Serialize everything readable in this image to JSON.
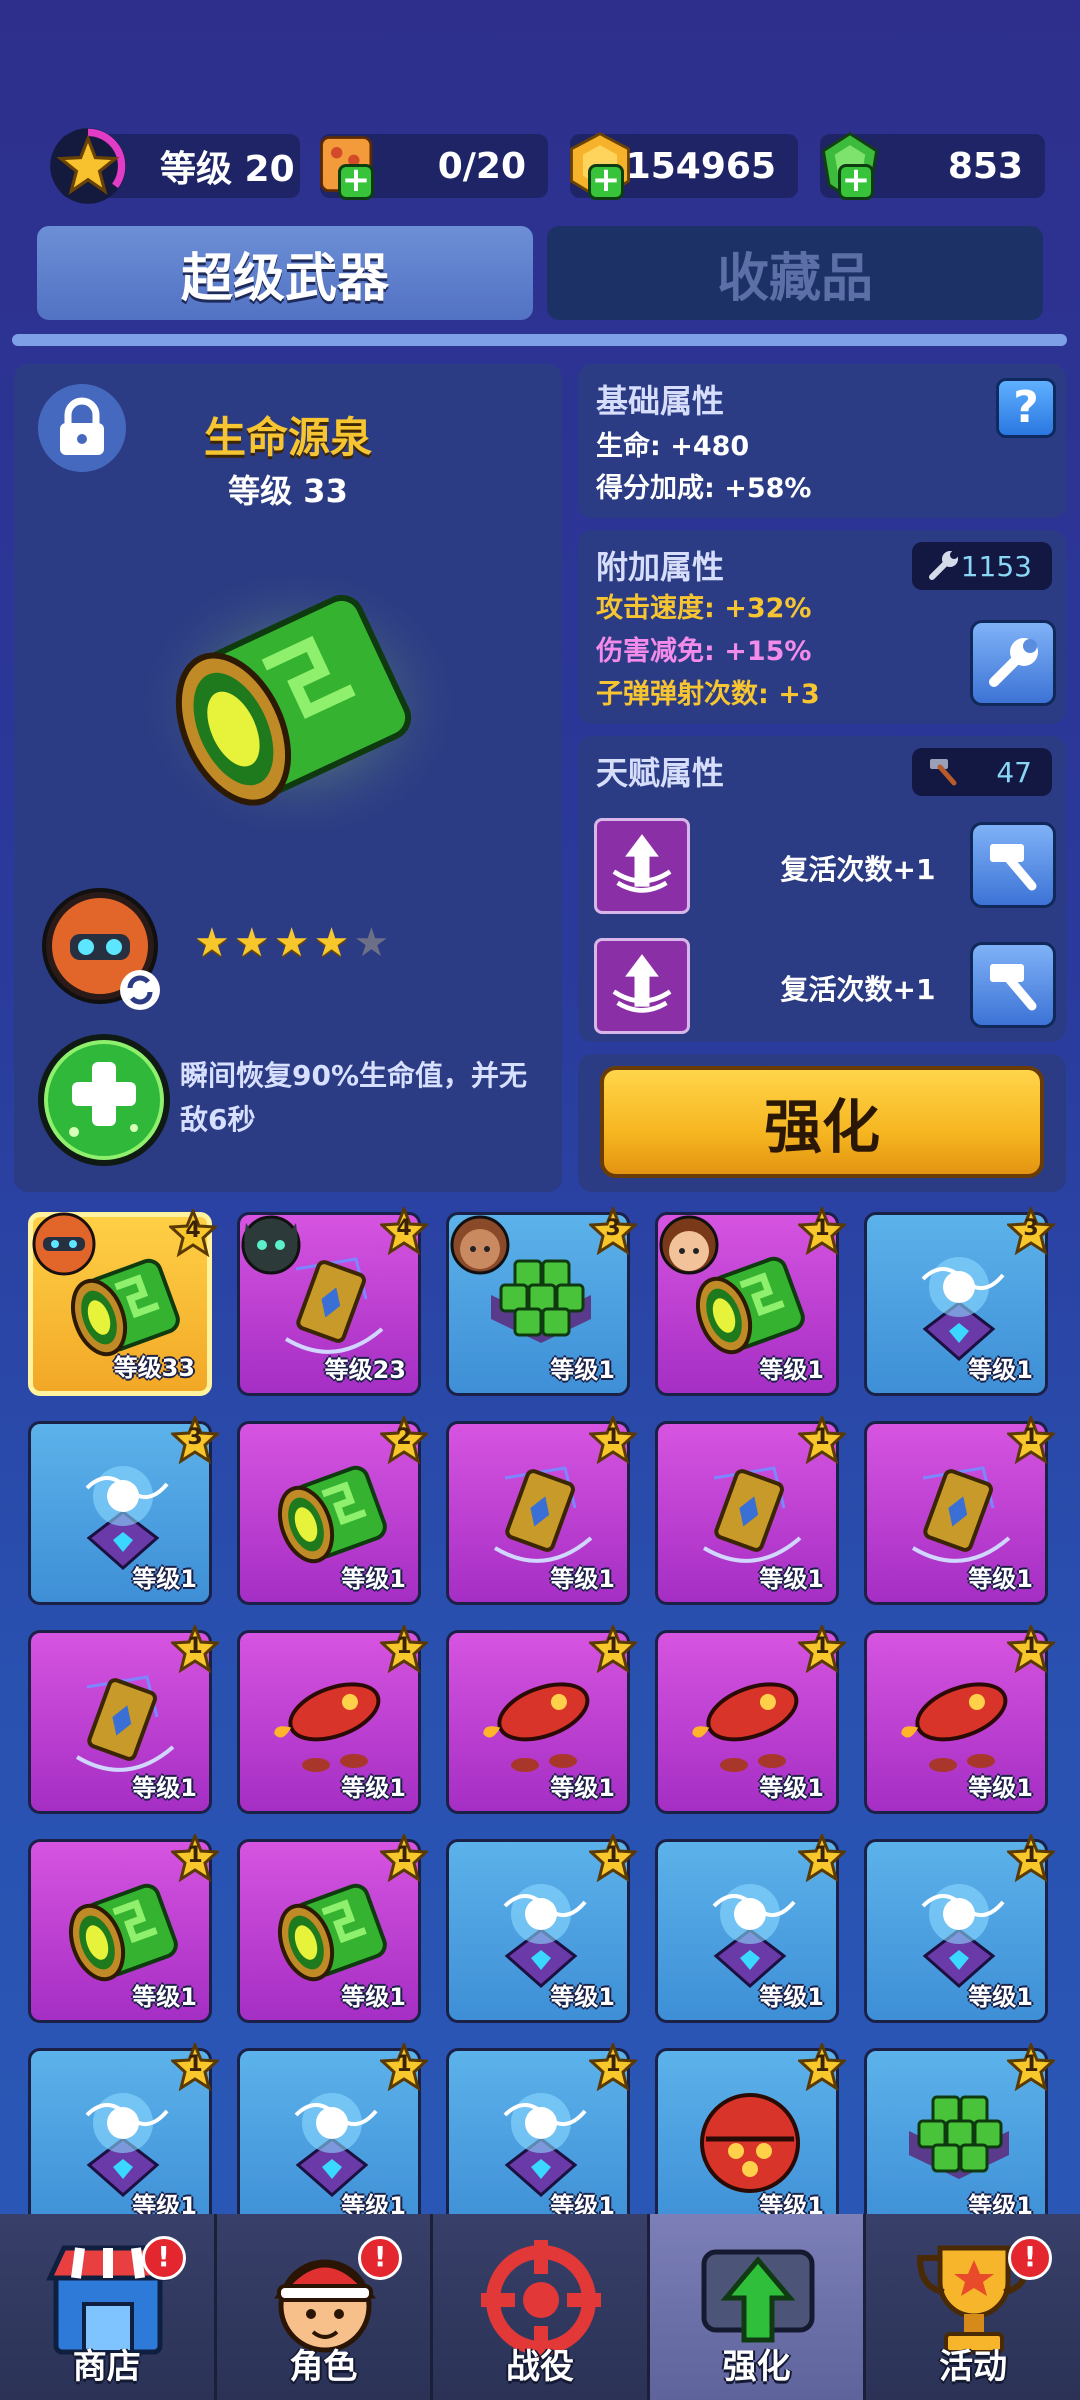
{
  "colors": {
    "background": "#2b3d9f",
    "accent_gold": "#f6c531",
    "attack_speed": "#f6c531",
    "damage_reduction": "#f28bea",
    "bullet_bounce": "#f6c531",
    "card_blue": "#4ea0e0",
    "card_purple": "#c041d4",
    "card_gold": "#f7b62c"
  },
  "top_bar": {
    "level_label": "等级 20",
    "level_progress": 0.35,
    "energy": "0/20",
    "coins": "154965",
    "gems": "853"
  },
  "tabs": [
    {
      "label": "超级武器",
      "active": true
    },
    {
      "label": "收藏品",
      "active": false
    }
  ],
  "weapon": {
    "name": "生命源泉",
    "level": "等级 33",
    "stars": 4,
    "max_stars": 5,
    "skill_description": "瞬间恢复90%生命值，并无敌6秒",
    "icon": "green-cylinder-canister"
  },
  "base_attributes": {
    "title": "基础属性",
    "help": "?",
    "lines": [
      "生命: +480",
      "得分加成: +58%"
    ]
  },
  "extra_attributes": {
    "title": "附加属性",
    "wrench_count": "1153",
    "lines": [
      "攻击速度: +32%",
      "伤害减免: +15%",
      "子弹弹射次数: +3"
    ]
  },
  "talent_attributes": {
    "title": "天赋属性",
    "hammer_count": "47",
    "items": [
      {
        "label": "复活次数+1"
      },
      {
        "label": "复活次数+1"
      }
    ]
  },
  "upgrade_button": "强化",
  "inventory": [
    {
      "art": "canister",
      "color": "gold",
      "level": "等级33",
      "stars": "4",
      "portrait": "robot"
    },
    {
      "art": "hammer",
      "color": "purple",
      "level": "等级23",
      "stars": "4",
      "portrait": "cat"
    },
    {
      "art": "cubes",
      "color": "blue",
      "level": "等级1",
      "stars": "3",
      "portrait": "girl"
    },
    {
      "art": "canister",
      "color": "purple",
      "level": "等级1",
      "stars": "1",
      "portrait": "boy"
    },
    {
      "art": "lightning",
      "color": "blue",
      "level": "等级1",
      "stars": "3",
      "portrait": ""
    },
    {
      "art": "lightning",
      "color": "blue",
      "level": "等级1",
      "stars": "3",
      "portrait": ""
    },
    {
      "art": "canister",
      "color": "purple",
      "level": "等级1",
      "stars": "2",
      "portrait": ""
    },
    {
      "art": "hammer",
      "color": "purple",
      "level": "等级1",
      "stars": "1",
      "portrait": ""
    },
    {
      "art": "hammer",
      "color": "purple",
      "level": "等级1",
      "stars": "1",
      "portrait": ""
    },
    {
      "art": "hammer",
      "color": "purple",
      "level": "等级1",
      "stars": "1",
      "portrait": ""
    },
    {
      "art": "hammer",
      "color": "purple",
      "level": "等级1",
      "stars": "1",
      "portrait": ""
    },
    {
      "art": "rocket",
      "color": "purple",
      "level": "等级1",
      "stars": "1",
      "portrait": ""
    },
    {
      "art": "rocket",
      "color": "purple",
      "level": "等级1",
      "stars": "1",
      "portrait": ""
    },
    {
      "art": "rocket",
      "color": "purple",
      "level": "等级1",
      "stars": "1",
      "portrait": ""
    },
    {
      "art": "rocket",
      "color": "purple",
      "level": "等级1",
      "stars": "1",
      "portrait": ""
    },
    {
      "art": "canister",
      "color": "purple",
      "level": "等级1",
      "stars": "1",
      "portrait": ""
    },
    {
      "art": "canister",
      "color": "purple",
      "level": "等级1",
      "stars": "1",
      "portrait": ""
    },
    {
      "art": "lightning",
      "color": "blue",
      "level": "等级1",
      "stars": "1",
      "portrait": ""
    },
    {
      "art": "lightning",
      "color": "blue",
      "level": "等级1",
      "stars": "1",
      "portrait": ""
    },
    {
      "art": "lightning",
      "color": "blue",
      "level": "等级1",
      "stars": "1",
      "portrait": ""
    },
    {
      "art": "lightning",
      "color": "blue",
      "level": "等级1",
      "stars": "1",
      "portrait": ""
    },
    {
      "art": "lightning",
      "color": "blue",
      "level": "等级1",
      "stars": "1",
      "portrait": ""
    },
    {
      "art": "lightning",
      "color": "blue",
      "level": "等级1",
      "stars": "1",
      "portrait": ""
    },
    {
      "art": "orb",
      "color": "blue",
      "level": "等级1",
      "stars": "1",
      "portrait": ""
    },
    {
      "art": "cubes",
      "color": "blue",
      "level": "等级1",
      "stars": "1",
      "portrait": ""
    }
  ],
  "nav": [
    {
      "label": "商店",
      "icon": "shop-icon",
      "alert": "!",
      "active": false
    },
    {
      "label": "角色",
      "icon": "character-icon",
      "alert": "!",
      "active": false
    },
    {
      "label": "战役",
      "icon": "battle-icon",
      "alert": "",
      "active": false
    },
    {
      "label": "强化",
      "icon": "upgrade-icon",
      "alert": "",
      "active": true
    },
    {
      "label": "活动",
      "icon": "events-icon",
      "alert": "!",
      "active": false
    }
  ]
}
